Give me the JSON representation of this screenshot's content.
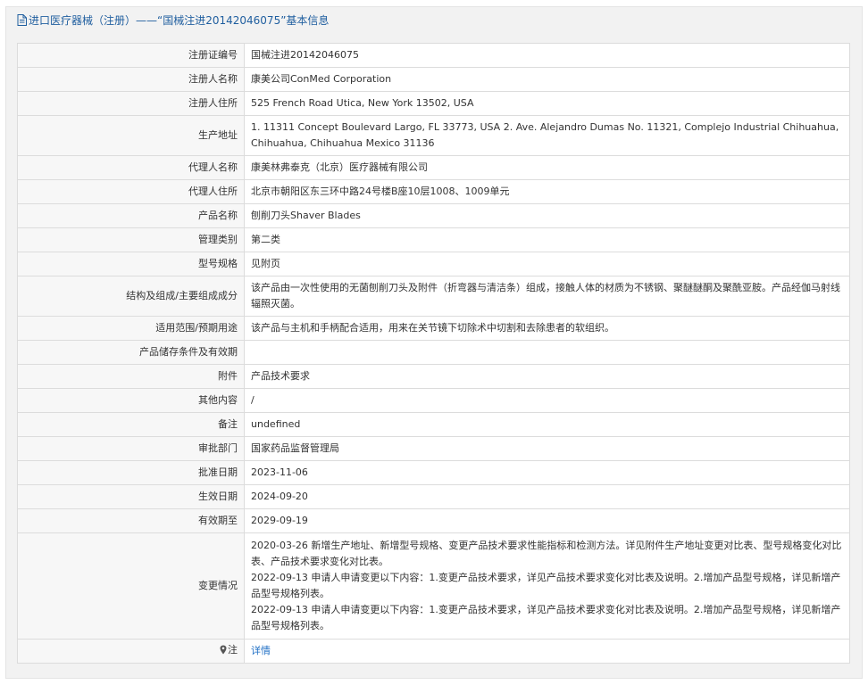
{
  "header": {
    "title": "进口医疗器械（注册）——“国械注进20142046075”基本信息"
  },
  "rows": [
    {
      "key": "注册证编号",
      "value": "国械注进20142046075"
    },
    {
      "key": "注册人名称",
      "value": "康美公司ConMed Corporation"
    },
    {
      "key": "注册人住所",
      "value": "525 French Road Utica, New York 13502, USA"
    },
    {
      "key": "生产地址",
      "value": "1. 11311 Concept Boulevard Largo, FL 33773, USA 2. Ave. Alejandro Dumas No. 11321, Complejo Industrial Chihuahua, Chihuahua, Chihuahua Mexico 31136"
    },
    {
      "key": "代理人名称",
      "value": "康美林弗泰克（北京）医疗器械有限公司"
    },
    {
      "key": "代理人住所",
      "value": "北京市朝阳区东三环中路24号楼B座10层1008、1009单元"
    },
    {
      "key": "产品名称",
      "value": "刨削刀头Shaver Blades"
    },
    {
      "key": "管理类别",
      "value": "第二类"
    },
    {
      "key": "型号规格",
      "value": "见附页"
    },
    {
      "key": "结构及组成/主要组成成分",
      "value": "该产品由一次性使用的无菌刨削刀头及附件（折弯器与清洁条）组成，接触人体的材质为不锈钢、聚醚醚酮及聚酰亚胺。产品经伽马射线辐照灭菌。"
    },
    {
      "key": "适用范围/预期用途",
      "value": "该产品与主机和手柄配合适用，用来在关节镜下切除术中切割和去除患者的软组织。"
    },
    {
      "key": "产品储存条件及有效期",
      "value": ""
    },
    {
      "key": "附件",
      "value": "产品技术要求"
    },
    {
      "key": "其他内容",
      "value": "/"
    },
    {
      "key": "备注",
      "value": "undefined"
    },
    {
      "key": "审批部门",
      "value": "国家药品监督管理局"
    },
    {
      "key": "批准日期",
      "value": "2023-11-06"
    },
    {
      "key": "生效日期",
      "value": "2024-09-20"
    },
    {
      "key": "有效期至",
      "value": "2029-09-19"
    }
  ],
  "changes": {
    "key": "变更情况",
    "items": [
      "2020-03-26 新增生产地址、新增型号规格、变更产品技术要求性能指标和检测方法。详见附件生产地址变更对比表、型号规格变化对比表、产品技术要求变化对比表。",
      "2022-09-13 申请人申请变更以下内容：1.变更产品技术要求，详见产品技术要求变化对比表及说明。2.增加产品型号规格，详见新增产品型号规格列表。",
      "2022-09-13 申请人申请变更以下内容：1.变更产品技术要求，详见产品技术要求变化对比表及说明。2.增加产品型号规格，详见新增产品型号规格列表。"
    ]
  },
  "note": {
    "key": "注",
    "link": "详情"
  },
  "icons": {
    "title": "document-icon",
    "note": "map-pin-icon"
  },
  "colors": {
    "title": "#1f5e9f",
    "link": "#1f6fc5"
  }
}
